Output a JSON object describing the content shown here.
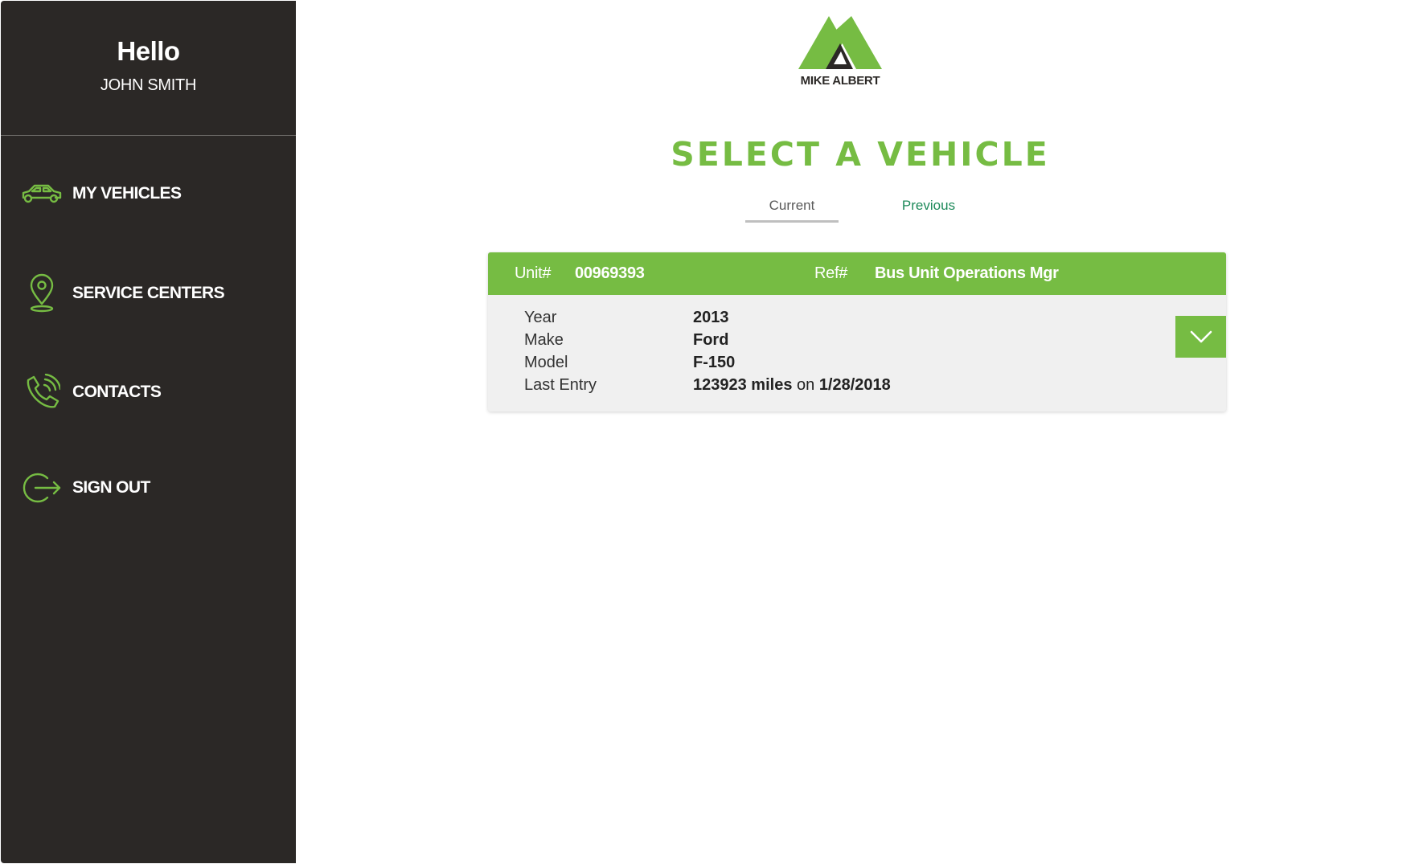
{
  "sidebar": {
    "greeting": "Hello",
    "username": "JOHN SMITH",
    "items": [
      {
        "label": "MY VEHICLES",
        "icon": "car-icon"
      },
      {
        "label": "SERVICE CENTERS",
        "icon": "map-pin-icon"
      },
      {
        "label": "CONTACTS",
        "icon": "phone-icon"
      },
      {
        "label": "SIGN OUT",
        "icon": "sign-out-icon"
      }
    ]
  },
  "brand": {
    "name": "MIKE ALBERT",
    "accent_color": "#76bc43",
    "sidebar_color": "#2b2826"
  },
  "main": {
    "title": "SELECT A VEHICLE",
    "tabs": [
      {
        "label": "Current",
        "selected": true
      },
      {
        "label": "Previous",
        "selected": false
      }
    ]
  },
  "vehicle": {
    "unit_label": "Unit#",
    "unit_value": "00969393",
    "ref_label": "Ref#",
    "ref_value": "Bus Unit Operations Mgr",
    "year_label": "Year",
    "year_value": "2013",
    "make_label": "Make",
    "make_value": "Ford",
    "model_label": "Model",
    "model_value": "F-150",
    "last_entry_label": "Last Entry",
    "last_entry_miles": "123923 miles",
    "last_entry_on": "on",
    "last_entry_date": "1/28/2018",
    "expand_icon": "chevron-down-icon"
  }
}
